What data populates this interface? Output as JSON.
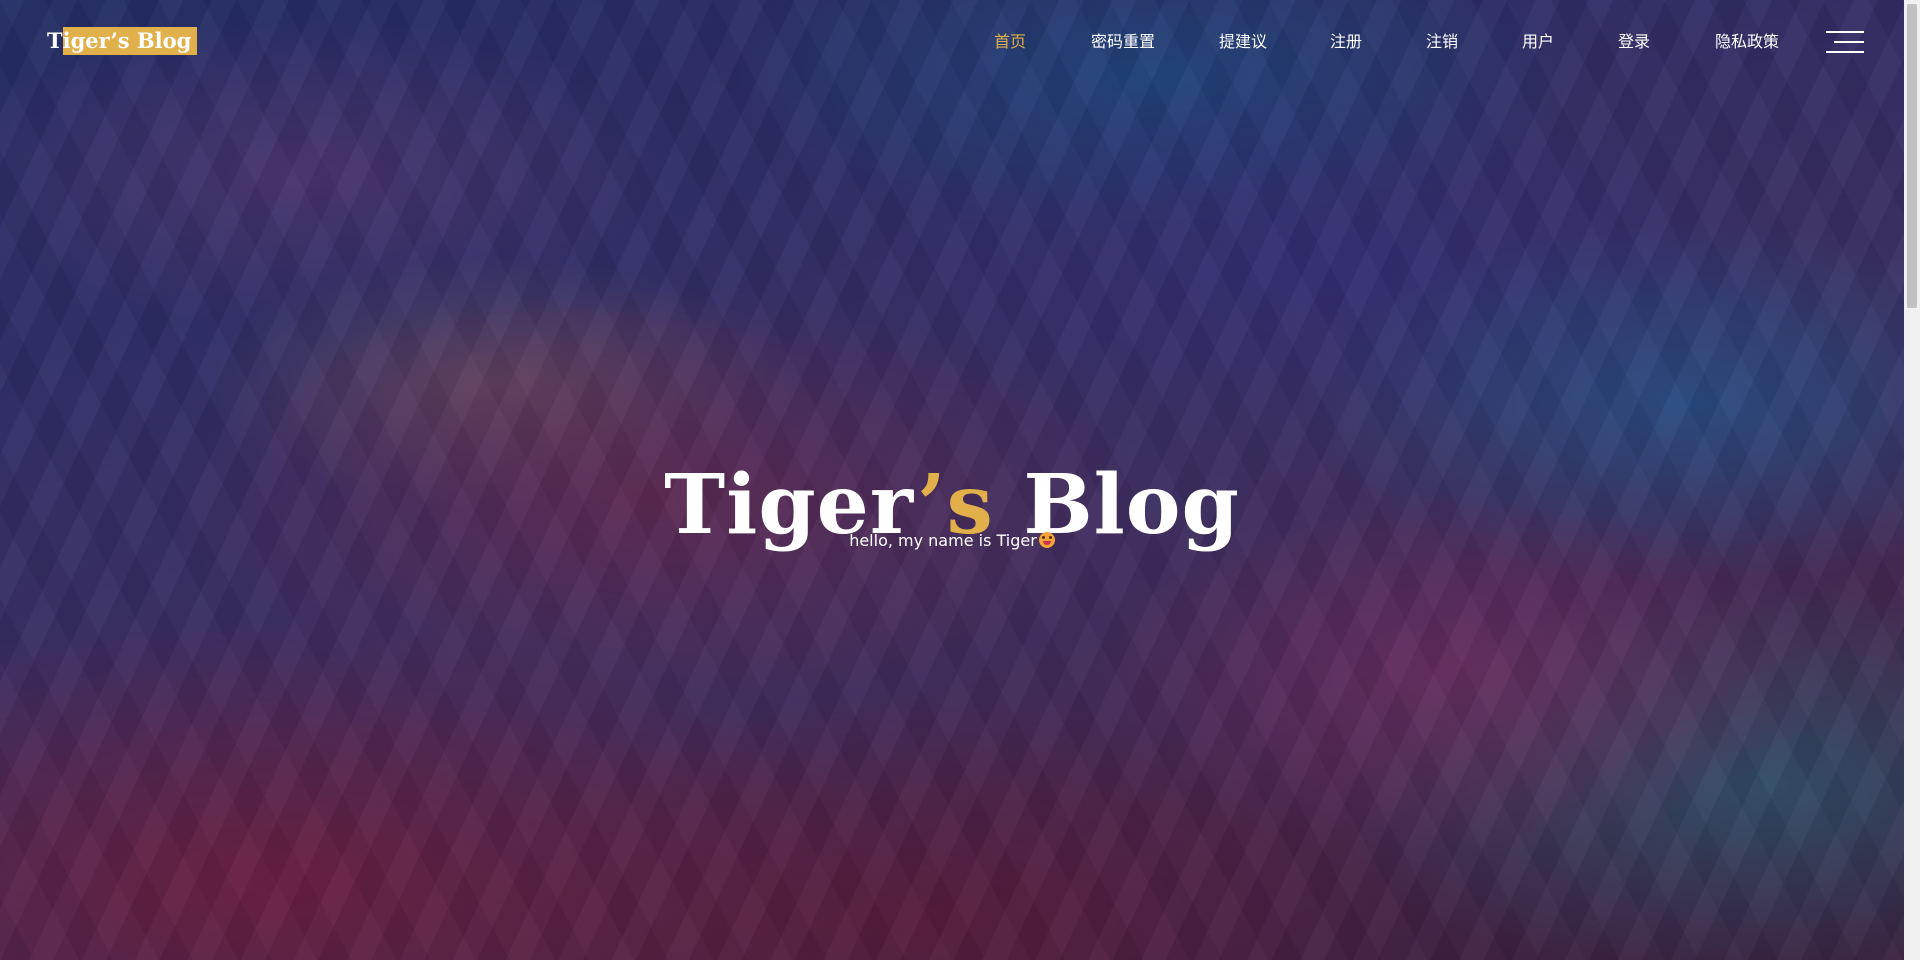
{
  "header": {
    "logo": "Tiger’s Blog"
  },
  "nav": {
    "items": [
      {
        "label": "首页",
        "active": true
      },
      {
        "label": "密码重置",
        "active": false
      },
      {
        "label": "提建议",
        "active": false
      },
      {
        "label": "注册",
        "active": false
      },
      {
        "label": "注销",
        "active": false
      },
      {
        "label": "用户",
        "active": false
      },
      {
        "label": "登录",
        "active": false
      },
      {
        "label": "隐私政策",
        "active": false
      }
    ],
    "menu_icon": "hamburger-menu-icon"
  },
  "hero": {
    "title_part1": "Tiger",
    "title_accent": "’s",
    "title_part2": " Blog",
    "subtitle": "hello, my name is Tiger",
    "subtitle_emoji": "grinning-face-with-tongue"
  },
  "colors": {
    "accent": "#e2b04a",
    "text": "#ffffff"
  }
}
